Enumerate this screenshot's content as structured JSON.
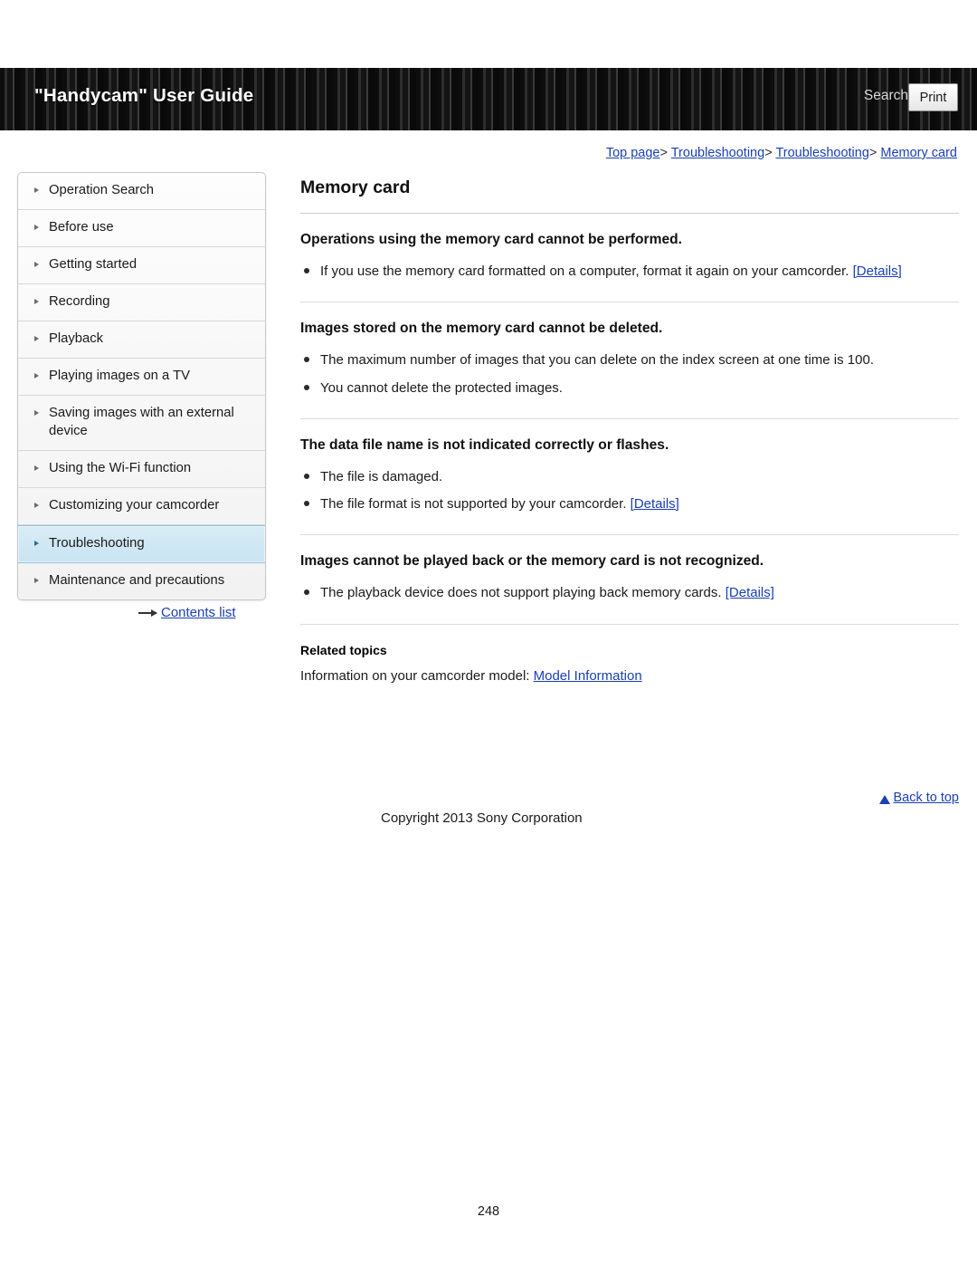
{
  "header": {
    "title": "\"Handycam\" User Guide",
    "search_label": "Search",
    "print_label": "Print"
  },
  "breadcrumb": {
    "items": [
      "Top page",
      "Troubleshooting",
      "Troubleshooting",
      "Memory card"
    ],
    "separator": ">"
  },
  "sidebar": {
    "items": [
      {
        "label": "Operation Search"
      },
      {
        "label": "Before use"
      },
      {
        "label": "Getting started"
      },
      {
        "label": "Recording"
      },
      {
        "label": "Playback"
      },
      {
        "label": "Playing images on a TV"
      },
      {
        "label": "Saving images with an external device"
      },
      {
        "label": "Using the Wi-Fi function"
      },
      {
        "label": "Customizing your camcorder"
      },
      {
        "label": "Troubleshooting"
      },
      {
        "label": "Maintenance and precautions"
      }
    ],
    "selected_index": 9,
    "contents_list_label": "Contents list"
  },
  "main": {
    "title": "Memory card",
    "sections": [
      {
        "heading": "Operations using the memory card cannot be performed.",
        "bullets": [
          {
            "text": "If you use the memory card formatted on a computer, format it again on your camcorder. ",
            "link": "[Details]"
          }
        ]
      },
      {
        "heading": "Images stored on the memory card cannot be deleted.",
        "bullets": [
          {
            "text": "The maximum number of images that you can delete on the index screen at one time is 100.",
            "link": ""
          },
          {
            "text": "You cannot delete the protected images.",
            "link": ""
          }
        ]
      },
      {
        "heading": "The data file name is not indicated correctly or flashes.",
        "bullets": [
          {
            "text": "The file is damaged.",
            "link": ""
          },
          {
            "text": "The file format is not supported by your camcorder. ",
            "link": "[Details]"
          }
        ]
      },
      {
        "heading": "Images cannot be played back or the memory card is not recognized.",
        "bullets": [
          {
            "text": "The playback device does not support playing back memory cards. ",
            "link": "[Details]"
          }
        ]
      }
    ],
    "related": {
      "title": "Related topics",
      "text": "Information on your camcorder model: ",
      "link": "Model Information"
    },
    "back_to_top": "Back to top",
    "copyright": "Copyright 2013 Sony Corporation",
    "page_number": "248"
  },
  "colors": {
    "link": "#1a3fb5",
    "header_bg": "#1a1a1a",
    "selected_nav": "#cfe7f3"
  }
}
